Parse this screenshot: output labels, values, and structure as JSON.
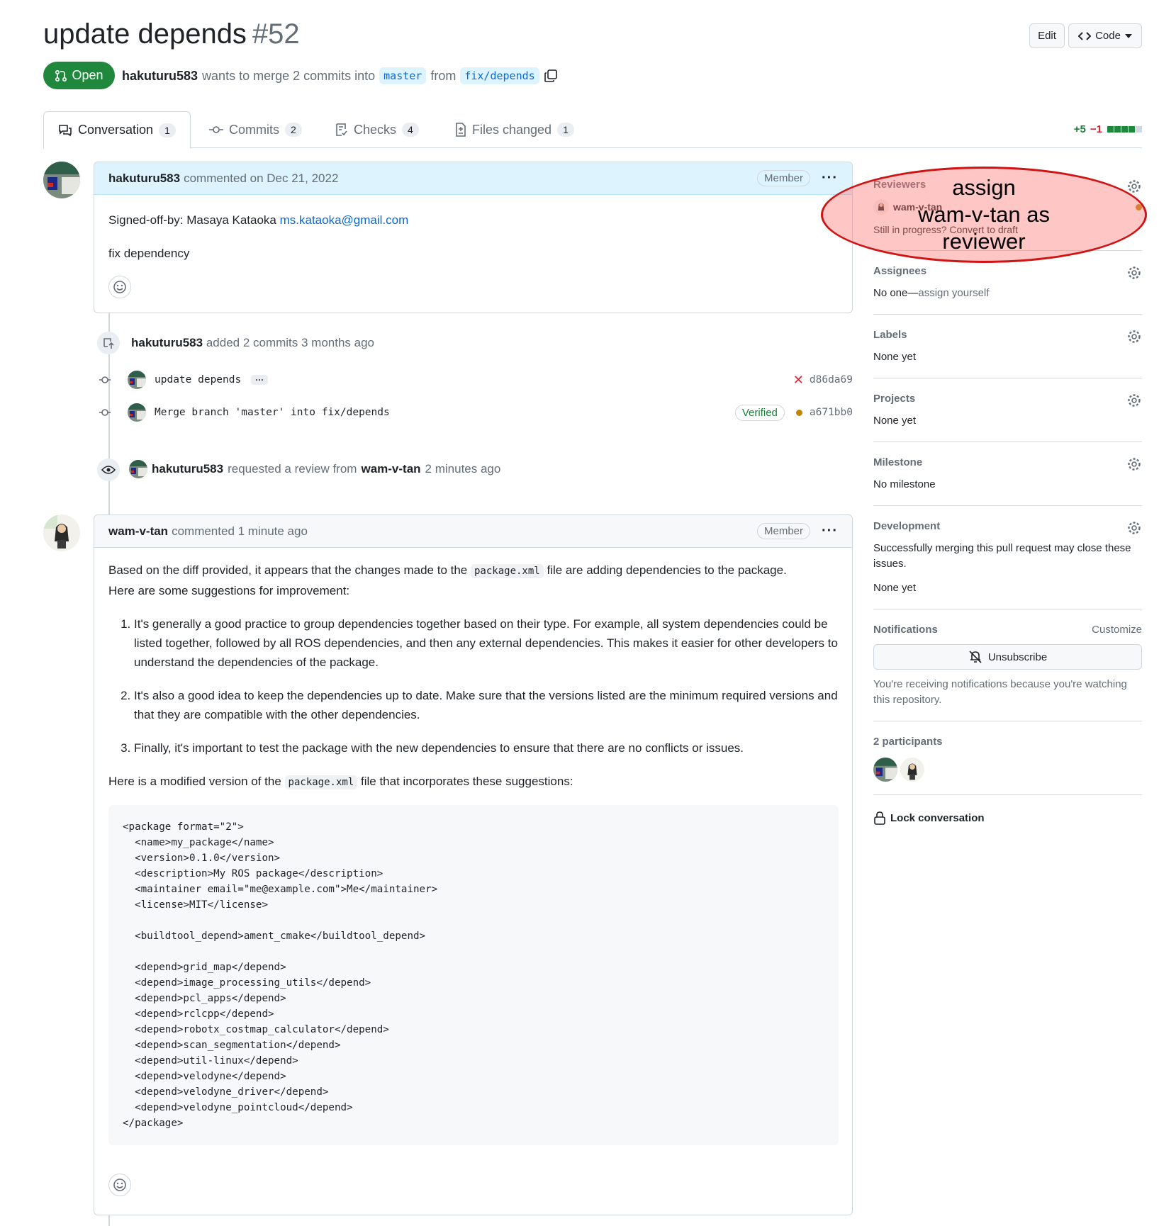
{
  "pr": {
    "title": "update depends",
    "number": "#52",
    "state": "Open",
    "author": "hakuturu583",
    "meta_mid": "wants to merge 2 commits into",
    "base_branch": "master",
    "meta_from": "from",
    "head_branch": "fix/depends"
  },
  "header_buttons": {
    "edit": "Edit",
    "code": "Code"
  },
  "tabs": [
    {
      "label": "Conversation",
      "count": "1"
    },
    {
      "label": "Commits",
      "count": "2"
    },
    {
      "label": "Checks",
      "count": "4"
    },
    {
      "label": "Files changed",
      "count": "1"
    }
  ],
  "diffstat": {
    "additions": "+5",
    "deletions": "−1"
  },
  "comment1": {
    "author": "hakuturu583",
    "action": "commented on Dec 21, 2022",
    "role": "Member",
    "signoff_prefix": "Signed-off-by: Masaya Kataoka",
    "signoff_email": "ms.kataoka@gmail.com",
    "text": "fix dependency"
  },
  "commits_event": {
    "author": "hakuturu583",
    "action": "added 2 commits 3 months ago",
    "commits": [
      {
        "message": "update depends",
        "sha": "d86da69",
        "status": "failed"
      },
      {
        "message": "Merge branch 'master' into fix/depends",
        "sha": "a671bb0",
        "badge": "Verified",
        "status": "pending"
      }
    ]
  },
  "review_event": {
    "author": "hakuturu583",
    "action": "requested a review from",
    "reviewer": "wam-v-tan",
    "time": "2 minutes ago"
  },
  "comment2": {
    "author": "wam-v-tan",
    "action": "commented 1 minute ago",
    "role": "Member",
    "intro_a": "Based on the diff provided, it appears that the changes made to the",
    "intro_code": "package.xml",
    "intro_b": "file are adding dependencies to the package.",
    "intro_c": "Here are some suggestions for improvement:",
    "items": [
      "It's generally a good practice to group dependencies together based on their type. For example, all system dependencies could be listed together, followed by all ROS dependencies, and then any external dependencies. This makes it easier for other developers to understand the dependencies of the package.",
      "It's also a good idea to keep the dependencies up to date. Make sure that the versions listed are the minimum required versions and that they are compatible with the other dependencies.",
      "Finally, it's important to test the package with the new dependencies to ensure that there are no conflicts or issues."
    ],
    "outro_a": "Here is a modified version of the",
    "outro_code": "package.xml",
    "outro_b": "file that incorporates these suggestions:",
    "code": "<package format=\"2\">\n  <name>my_package</name>\n  <version>0.1.0</version>\n  <description>My ROS package</description>\n  <maintainer email=\"me@example.com\">Me</maintainer>\n  <license>MIT</license>\n\n  <buildtool_depend>ament_cmake</buildtool_depend>\n\n  <depend>grid_map</depend>\n  <depend>image_processing_utils</depend>\n  <depend>pcl_apps</depend>\n  <depend>rclcpp</depend>\n  <depend>robotx_costmap_calculator</depend>\n  <depend>scan_segmentation</depend>\n  <depend>util-linux</depend>\n  <depend>velodyne</depend>\n  <depend>velodyne_driver</depend>\n  <depend>velodyne_pointcloud</depend>\n</package>"
  },
  "sidebar": {
    "reviewers": {
      "title": "Reviewers",
      "name": "wam-v-tan",
      "note": "Still in progress? Convert to draft"
    },
    "assignees": {
      "title": "Assignees",
      "value_a": "No one—",
      "value_b": "assign yourself"
    },
    "labels": {
      "title": "Labels",
      "value": "None yet"
    },
    "projects": {
      "title": "Projects",
      "value": "None yet"
    },
    "milestone": {
      "title": "Milestone",
      "value": "No milestone"
    },
    "development": {
      "title": "Development",
      "note": "Successfully merging this pull request may close these issues.",
      "value": "None yet"
    },
    "notifications": {
      "title": "Notifications",
      "customize": "Customize",
      "button": "Unsubscribe",
      "note": "You're receiving notifications because you're watching this repository."
    },
    "participants": {
      "title": "2 participants"
    },
    "lock": "Lock conversation"
  },
  "annotation": {
    "line1": "assign",
    "line2": "wam-v-tan as",
    "line3": "reviewer"
  },
  "colors": {
    "open_green": "#1f883d",
    "link_blue": "#0969da",
    "annotation_red": "#d01414"
  }
}
